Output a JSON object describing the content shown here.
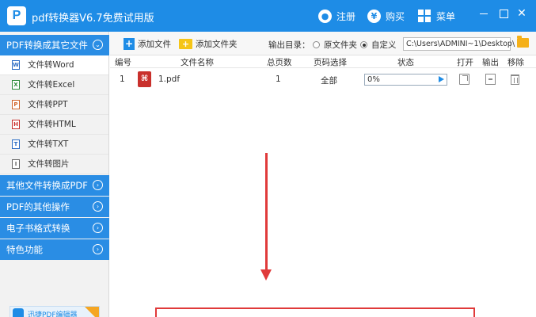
{
  "app": {
    "logo_letter": "P",
    "title": "pdf转换器V6.7免费试用版"
  },
  "titlebar": {
    "register_icon": "user-icon",
    "register_label": "注册",
    "buy_icon": "yen-icon",
    "buy_glyph": "¥",
    "buy_label": "购买",
    "menu_icon": "grid-icon",
    "menu_label": "菜单",
    "close_glyph": "✕"
  },
  "sidebar": {
    "categories": [
      {
        "label": "PDF转换成其它文件",
        "expanded": true
      },
      {
        "label": "其他文件转换成PDF"
      },
      {
        "label": "PDF的其他操作"
      },
      {
        "label": "电子书格式转换"
      },
      {
        "label": "特色功能"
      }
    ],
    "items": [
      {
        "label": "文件转Word",
        "icon_glyph": "W",
        "icon": "word-icon"
      },
      {
        "label": "文件转Excel",
        "icon_glyph": "X",
        "icon": "excel-icon"
      },
      {
        "label": "文件转PPT",
        "icon_glyph": "P",
        "icon": "ppt-icon"
      },
      {
        "label": "文件转HTML",
        "icon_glyph": "H",
        "icon": "html-icon"
      },
      {
        "label": "文件转TXT",
        "icon_glyph": "T",
        "icon": "txt-icon"
      },
      {
        "label": "文件转图片",
        "icon_glyph": "I",
        "icon": "image-icon"
      }
    ],
    "chevron_collapsed": "›",
    "chevron_expanded": "⌄",
    "promo_text": "迅捷PDF编辑器"
  },
  "toolbar": {
    "add_file_label": "添加文件",
    "add_folder_label": "添加文件夹",
    "output_dir_label": "输出目录：",
    "radio_original": "原文件夹",
    "radio_custom": "自定义",
    "selected_radio": "custom",
    "output_path": "C:\\Users\\ADMINI~1\\Desktop\\"
  },
  "table": {
    "headers": [
      "编号",
      "文件名称",
      "总页数",
      "页码选择",
      "状态",
      "打开",
      "输出",
      "移除"
    ],
    "rows": [
      {
        "index": "1",
        "filename": "1.pdf",
        "pages": "1",
        "page_selection": "全部",
        "status": "0%",
        "progress": 0
      }
    ]
  },
  "colors": {
    "brand": "#1e8ce6",
    "sidebar_category": "#2a8de4",
    "annotation": "#e03a3a",
    "pdf_icon": "#c9302c"
  }
}
